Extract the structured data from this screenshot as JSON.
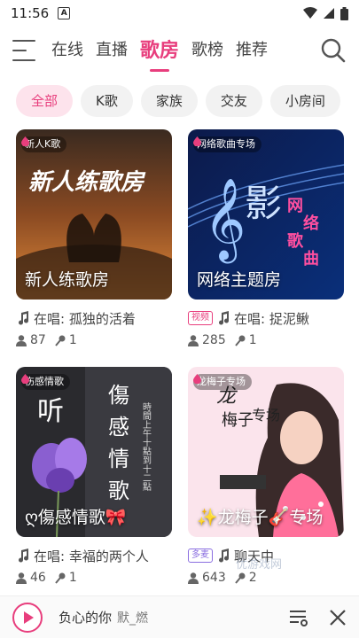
{
  "status": {
    "time": "11:56",
    "notification_icon": "A"
  },
  "nav": {
    "tabs": [
      {
        "label": "在线"
      },
      {
        "label": "直播"
      },
      {
        "label": "歌房",
        "active": true
      },
      {
        "label": "歌榜"
      },
      {
        "label": "推荐"
      }
    ]
  },
  "filters": [
    {
      "label": "全部",
      "active": true
    },
    {
      "label": "K歌"
    },
    {
      "label": "家族"
    },
    {
      "label": "交友"
    },
    {
      "label": "小房间"
    }
  ],
  "rooms": [
    {
      "tag": "新人K歌",
      "title": "新人练歌房",
      "badge": "",
      "song": "在唱: 孤独的活着",
      "listeners": "87",
      "mics": "1"
    },
    {
      "tag": "网络歌曲专场",
      "title": "网络主题房",
      "badge": "视频",
      "song": "在唱: 捉泥鳅",
      "listeners": "285",
      "mics": "1"
    },
    {
      "tag": "伤感情歌",
      "title": "ღ傷感情歌🎀",
      "badge": "",
      "song": "在唱: 幸福的两个人",
      "listeners": "46",
      "mics": "1"
    },
    {
      "tag": "龙梅子专场",
      "title": "✨龙梅子🎸专场",
      "badge": "多麦",
      "song": "聊天中",
      "listeners": "643",
      "mics": "2"
    }
  ],
  "player": {
    "song": "负心的你",
    "artist": "默_燃"
  },
  "watermark": "优游戏网",
  "colors": {
    "accent": "#e83e7d"
  },
  "icons": [
    "menu-icon",
    "search-icon",
    "music-note-icon",
    "person-icon",
    "mic-icon",
    "playlist-icon",
    "close-icon",
    "play-icon"
  ]
}
